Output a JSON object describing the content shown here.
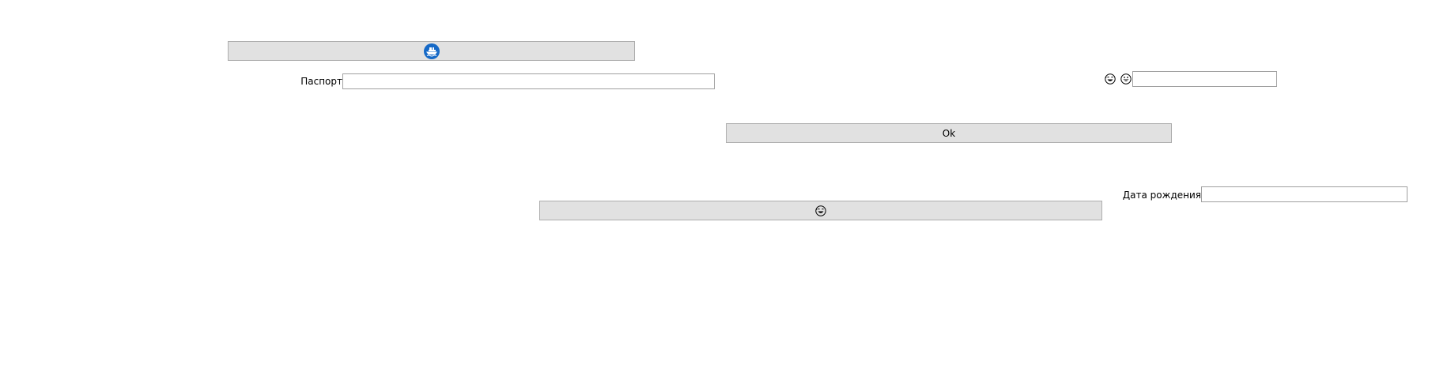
{
  "form": {
    "button_top": {
      "icon": "ship-badge-icon",
      "label": ""
    },
    "passport": {
      "label": "Паспорт",
      "value": "",
      "placeholder": ""
    },
    "face_row": {
      "icons": [
        "grinning-sweat-face-icon",
        "grinning-face-icon"
      ],
      "value": "",
      "placeholder": ""
    },
    "ok_button": {
      "label": "Ok"
    },
    "birth_date": {
      "label": "Дата рождения",
      "value": "",
      "placeholder": ""
    },
    "button_bottom": {
      "icon": "grinning-sweat-face-icon",
      "label": ""
    }
  },
  "colors": {
    "button_bg": "#e1e1e1",
    "button_border": "#adadad",
    "field_border": "#a0a0a0",
    "badge_blue": "#1569c7"
  }
}
